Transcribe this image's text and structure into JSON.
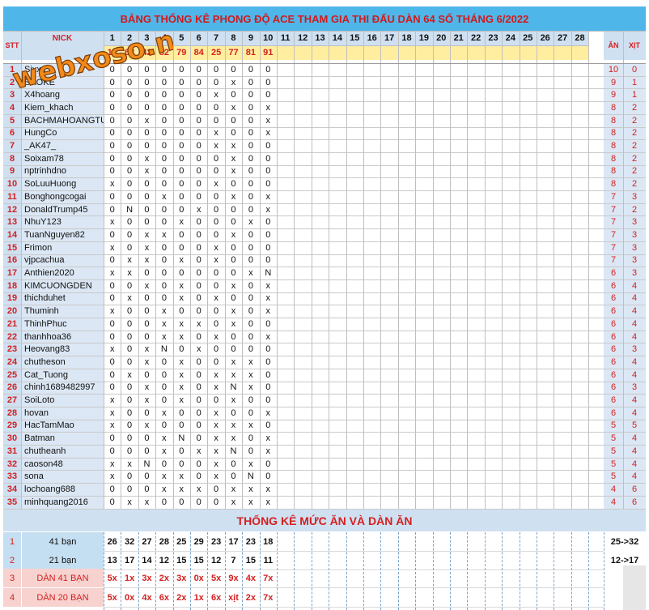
{
  "title": "BẢNG THỐNG KÊ PHONG ĐỘ ACE THAM GIA THI ĐẤU DÀN 64 SỐ THÁNG 6/2022",
  "watermark": "webxoso.net",
  "headers": {
    "stt": "STT",
    "nick": "NICK",
    "an": "ĂN",
    "xit": "XỊT"
  },
  "days": [
    "1",
    "2",
    "3",
    "4",
    "5",
    "6",
    "7",
    "8",
    "9",
    "10",
    "11",
    "12",
    "13",
    "14",
    "15",
    "16",
    "17",
    "18",
    "19",
    "20",
    "21",
    "22",
    "23",
    "24",
    "25",
    "26",
    "27",
    "28"
  ],
  "day_results": [
    "18",
    "68",
    "42",
    "32",
    "79",
    "84",
    "25",
    "77",
    "81",
    "91"
  ],
  "players": [
    {
      "stt": "1",
      "nick": "Sixxe",
      "r": [
        "0",
        "0",
        "0",
        "0",
        "0",
        "0",
        "0",
        "0",
        "0",
        "0"
      ],
      "an": "10",
      "xit": "0"
    },
    {
      "stt": "2",
      "nick": "SAOKE",
      "r": [
        "0",
        "0",
        "0",
        "0",
        "0",
        "0",
        "0",
        "x",
        "0",
        "0"
      ],
      "an": "9",
      "xit": "1"
    },
    {
      "stt": "3",
      "nick": "X4hoang",
      "r": [
        "0",
        "0",
        "0",
        "0",
        "0",
        "0",
        "x",
        "0",
        "0",
        "0"
      ],
      "an": "9",
      "xit": "1"
    },
    {
      "stt": "4",
      "nick": "Kiem_khach",
      "r": [
        "0",
        "0",
        "0",
        "0",
        "0",
        "0",
        "0",
        "x",
        "0",
        "x"
      ],
      "an": "8",
      "xit": "2"
    },
    {
      "stt": "5",
      "nick": "BACHMAHOANGTU",
      "r": [
        "0",
        "0",
        "x",
        "0",
        "0",
        "0",
        "0",
        "0",
        "0",
        "x"
      ],
      "an": "8",
      "xit": "2"
    },
    {
      "stt": "6",
      "nick": "HungCo",
      "r": [
        "0",
        "0",
        "0",
        "0",
        "0",
        "0",
        "x",
        "0",
        "0",
        "x"
      ],
      "an": "8",
      "xit": "2"
    },
    {
      "stt": "7",
      "nick": "_AK47_",
      "r": [
        "0",
        "0",
        "0",
        "0",
        "0",
        "0",
        "x",
        "x",
        "0",
        "0"
      ],
      "an": "8",
      "xit": "2"
    },
    {
      "stt": "8",
      "nick": "Soixam78",
      "r": [
        "0",
        "0",
        "x",
        "0",
        "0",
        "0",
        "0",
        "x",
        "0",
        "0"
      ],
      "an": "8",
      "xit": "2"
    },
    {
      "stt": "9",
      "nick": "nptrinhdno",
      "r": [
        "0",
        "0",
        "x",
        "0",
        "0",
        "0",
        "0",
        "x",
        "0",
        "0"
      ],
      "an": "8",
      "xit": "2"
    },
    {
      "stt": "10",
      "nick": "SoLuuHuong",
      "r": [
        "x",
        "0",
        "0",
        "0",
        "0",
        "0",
        "x",
        "0",
        "0",
        "0"
      ],
      "an": "8",
      "xit": "2"
    },
    {
      "stt": "11",
      "nick": "Bonghongcogai",
      "r": [
        "0",
        "0",
        "0",
        "x",
        "0",
        "0",
        "0",
        "x",
        "0",
        "x"
      ],
      "an": "7",
      "xit": "3"
    },
    {
      "stt": "12",
      "nick": "DonaldTrump45",
      "r": [
        "0",
        "N",
        "0",
        "0",
        "0",
        "x",
        "0",
        "0",
        "0",
        "x"
      ],
      "an": "7",
      "xit": "2"
    },
    {
      "stt": "13",
      "nick": "NhuY123",
      "r": [
        "x",
        "0",
        "0",
        "0",
        "x",
        "0",
        "0",
        "0",
        "x",
        "0"
      ],
      "an": "7",
      "xit": "3"
    },
    {
      "stt": "14",
      "nick": "TuanNguyen82",
      "r": [
        "0",
        "0",
        "x",
        "x",
        "0",
        "0",
        "0",
        "x",
        "0",
        "0"
      ],
      "an": "7",
      "xit": "3"
    },
    {
      "stt": "15",
      "nick": "Frimon",
      "r": [
        "x",
        "0",
        "x",
        "0",
        "0",
        "0",
        "x",
        "0",
        "0",
        "0"
      ],
      "an": "7",
      "xit": "3"
    },
    {
      "stt": "16",
      "nick": "vjpcachua",
      "r": [
        "0",
        "x",
        "x",
        "0",
        "x",
        "0",
        "x",
        "0",
        "0",
        "0"
      ],
      "an": "7",
      "xit": "3"
    },
    {
      "stt": "17",
      "nick": "Anthien2020",
      "r": [
        "x",
        "x",
        "0",
        "0",
        "0",
        "0",
        "0",
        "0",
        "x",
        "N"
      ],
      "an": "6",
      "xit": "3"
    },
    {
      "stt": "18",
      "nick": "KIMCUONGDEN",
      "r": [
        "0",
        "0",
        "x",
        "0",
        "x",
        "0",
        "0",
        "x",
        "0",
        "x"
      ],
      "an": "6",
      "xit": "4"
    },
    {
      "stt": "19",
      "nick": "thichduhet",
      "r": [
        "0",
        "x",
        "0",
        "0",
        "x",
        "0",
        "x",
        "0",
        "0",
        "x"
      ],
      "an": "6",
      "xit": "4"
    },
    {
      "stt": "20",
      "nick": "Thuminh",
      "r": [
        "x",
        "0",
        "0",
        "x",
        "0",
        "0",
        "0",
        "x",
        "0",
        "x"
      ],
      "an": "6",
      "xit": "4"
    },
    {
      "stt": "21",
      "nick": "ThinhPhuc",
      "r": [
        "0",
        "0",
        "0",
        "x",
        "x",
        "x",
        "0",
        "x",
        "0",
        "0"
      ],
      "an": "6",
      "xit": "4"
    },
    {
      "stt": "22",
      "nick": "thanhhoa36",
      "r": [
        "0",
        "0",
        "0",
        "x",
        "x",
        "0",
        "x",
        "0",
        "0",
        "x"
      ],
      "an": "6",
      "xit": "4"
    },
    {
      "stt": "23",
      "nick": "Heovang83",
      "r": [
        "x",
        "0",
        "x",
        "N",
        "0",
        "x",
        "0",
        "0",
        "0",
        "0"
      ],
      "an": "6",
      "xit": "3"
    },
    {
      "stt": "24",
      "nick": "chutheson",
      "r": [
        "0",
        "0",
        "x",
        "0",
        "x",
        "0",
        "0",
        "x",
        "x",
        "0"
      ],
      "an": "6",
      "xit": "4"
    },
    {
      "stt": "25",
      "nick": "Cat_Tuong",
      "r": [
        "0",
        "x",
        "0",
        "0",
        "x",
        "0",
        "x",
        "x",
        "x",
        "0"
      ],
      "an": "6",
      "xit": "4"
    },
    {
      "stt": "26",
      "nick": "chinh1689482997",
      "r": [
        "0",
        "0",
        "x",
        "0",
        "x",
        "0",
        "x",
        "N",
        "x",
        "0"
      ],
      "an": "6",
      "xit": "3"
    },
    {
      "stt": "27",
      "nick": "SoiLoto",
      "r": [
        "x",
        "0",
        "x",
        "0",
        "x",
        "0",
        "0",
        "x",
        "0",
        "0"
      ],
      "an": "6",
      "xit": "4"
    },
    {
      "stt": "28",
      "nick": "hovan",
      "r": [
        "x",
        "0",
        "0",
        "x",
        "0",
        "0",
        "x",
        "0",
        "0",
        "x"
      ],
      "an": "6",
      "xit": "4"
    },
    {
      "stt": "29",
      "nick": "HacTamMao",
      "r": [
        "x",
        "0",
        "x",
        "0",
        "0",
        "0",
        "x",
        "x",
        "x",
        "0"
      ],
      "an": "5",
      "xit": "5"
    },
    {
      "stt": "30",
      "nick": "Batman",
      "r": [
        "0",
        "0",
        "0",
        "x",
        "N",
        "0",
        "x",
        "x",
        "0",
        "x"
      ],
      "an": "5",
      "xit": "4"
    },
    {
      "stt": "31",
      "nick": "chutheanh",
      "r": [
        "0",
        "0",
        "0",
        "x",
        "0",
        "x",
        "x",
        "N",
        "0",
        "x"
      ],
      "an": "5",
      "xit": "4"
    },
    {
      "stt": "32",
      "nick": "caoson48",
      "r": [
        "x",
        "x",
        "N",
        "0",
        "0",
        "0",
        "x",
        "0",
        "x",
        "0"
      ],
      "an": "5",
      "xit": "4"
    },
    {
      "stt": "33",
      "nick": "sona",
      "r": [
        "x",
        "0",
        "0",
        "x",
        "x",
        "0",
        "x",
        "0",
        "N",
        "0"
      ],
      "an": "5",
      "xit": "4"
    },
    {
      "stt": "34",
      "nick": "lochoang688",
      "r": [
        "0",
        "0",
        "0",
        "x",
        "x",
        "x",
        "0",
        "x",
        "x",
        "x"
      ],
      "an": "4",
      "xit": "6"
    },
    {
      "stt": "35",
      "nick": "minhquang2016",
      "r": [
        "0",
        "x",
        "x",
        "0",
        "0",
        "0",
        "0",
        "x",
        "x",
        "x"
      ],
      "an": "4",
      "xit": "6"
    }
  ],
  "stats_title": "THỐNG KÊ MỨC ĂN VÀ DÀN ĂN",
  "stats": [
    {
      "stt": "1",
      "label": "41 bạn",
      "values": [
        "26",
        "32",
        "27",
        "28",
        "25",
        "29",
        "23",
        "17",
        "23",
        "18"
      ],
      "range": "25->32",
      "style": "blue"
    },
    {
      "stt": "2",
      "label": "21 bạn",
      "values": [
        "13",
        "17",
        "14",
        "12",
        "15",
        "15",
        "12",
        "7",
        "15",
        "11"
      ],
      "range": "12->17",
      "style": "blue"
    },
    {
      "stt": "3",
      "label": "DÀN 41 BẠN",
      "values": [
        "5x",
        "1x",
        "3x",
        "2x",
        "3x",
        "0x",
        "5x",
        "9x",
        "4x",
        "7x"
      ],
      "range": "",
      "style": "pink"
    },
    {
      "stt": "4",
      "label": "DÀN 20 BẠN",
      "values": [
        "5x",
        "0x",
        "4x",
        "6x",
        "2x",
        "1x",
        "6x",
        "xịt",
        "2x",
        "7x"
      ],
      "range": "",
      "style": "pink"
    }
  ],
  "colors": {
    "title_bg": "#4fb6ea",
    "header_blue": "#cfe0f1",
    "header_yellow": "#ffeea0",
    "red_text": "#d42020",
    "watermark_orange": "#f28a1b"
  }
}
